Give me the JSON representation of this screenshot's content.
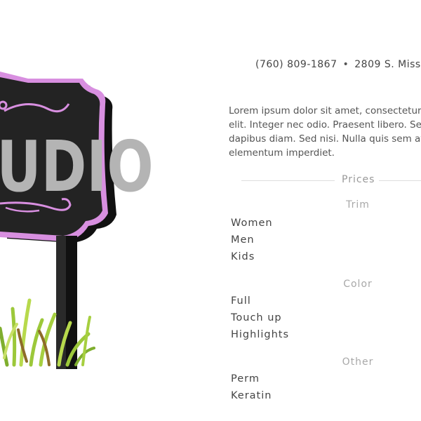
{
  "header": {
    "phone": "(760) 809-1867",
    "separator": "•",
    "address": "2809 S. Miss"
  },
  "intro": {
    "lines": [
      "Lorem ipsum dolor sit amet, consectetur",
      "elit. Integer nec odio. Praesent libero. Se",
      "dapibus diam. Sed nisi. Nulla quis sem at",
      "elementum imperdiet."
    ]
  },
  "sign": {
    "text": "UDIO"
  },
  "prices": {
    "heading": "Prices",
    "sections": [
      {
        "title": "Trim",
        "items": [
          "Women",
          "Men",
          "Kids"
        ]
      },
      {
        "title": "Color",
        "items": [
          "Full",
          "Touch up",
          "Highlights"
        ]
      },
      {
        "title": "Other",
        "items": [
          "Perm",
          "Keratin"
        ]
      }
    ]
  },
  "colors": {
    "sign_board": "#232323",
    "sign_trim": "#d88fe0",
    "sign_text": "#b4b4b4",
    "grass": "#9cc83a"
  }
}
